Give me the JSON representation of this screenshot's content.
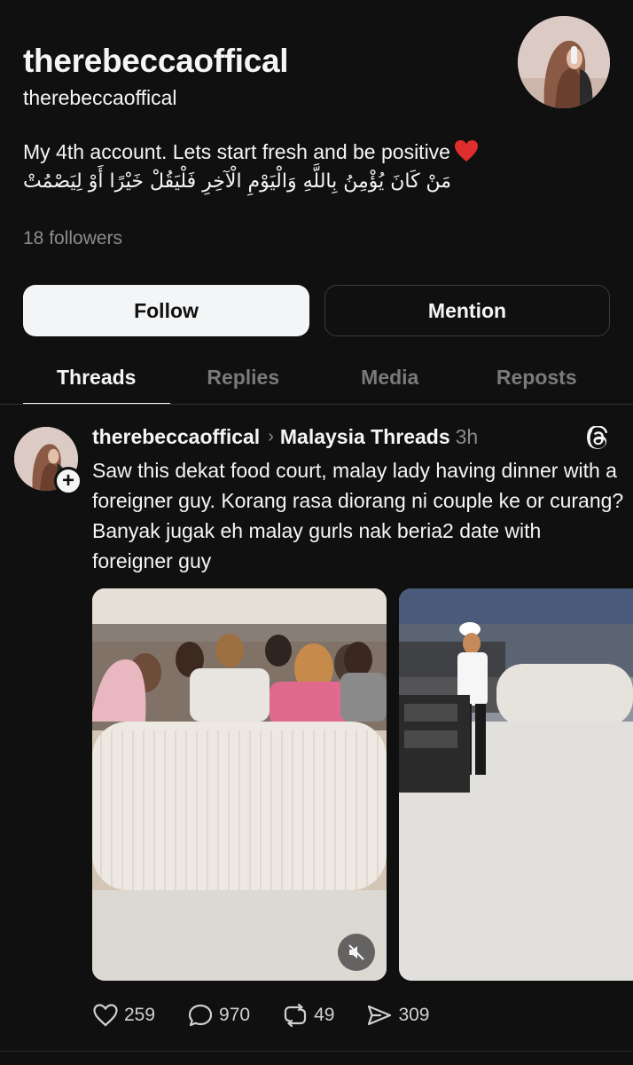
{
  "profile": {
    "name": "therebeccaoffical",
    "handle": "therebeccaoffical",
    "bio_line1": "My 4th account. Lets start fresh and be positive",
    "bio_line2": "مَنْ كَانَ يُؤْمِنُ بِاللَّهِ وَالْيَوْمِ الْآخِرِ فَلْيَقُلْ خَيْرًا أَوْ لِيَصْمُتْ",
    "followers": "18 followers"
  },
  "buttons": {
    "follow": "Follow",
    "mention": "Mention"
  },
  "tabs": [
    {
      "label": "Threads",
      "active": true
    },
    {
      "label": "Replies",
      "active": false
    },
    {
      "label": "Media",
      "active": false
    },
    {
      "label": "Reposts",
      "active": false
    }
  ],
  "post": {
    "author": "therebeccaoffical",
    "separator": "›",
    "community": "Malaysia Threads",
    "time": "3h",
    "text": "Saw this dekat food court, malay lady having dinner with a foreigner guy. Korang rasa diorang ni couple ke or curang? Banyak jugak eh malay gurls nak beria2 date with foreigner guy",
    "likes": "259",
    "comments": "970",
    "reposts": "49",
    "shares": "309"
  },
  "colors": {
    "background": "#101010",
    "text": "#f3f5f7",
    "muted": "#8c8c8c",
    "heart": "#e02d2d"
  }
}
